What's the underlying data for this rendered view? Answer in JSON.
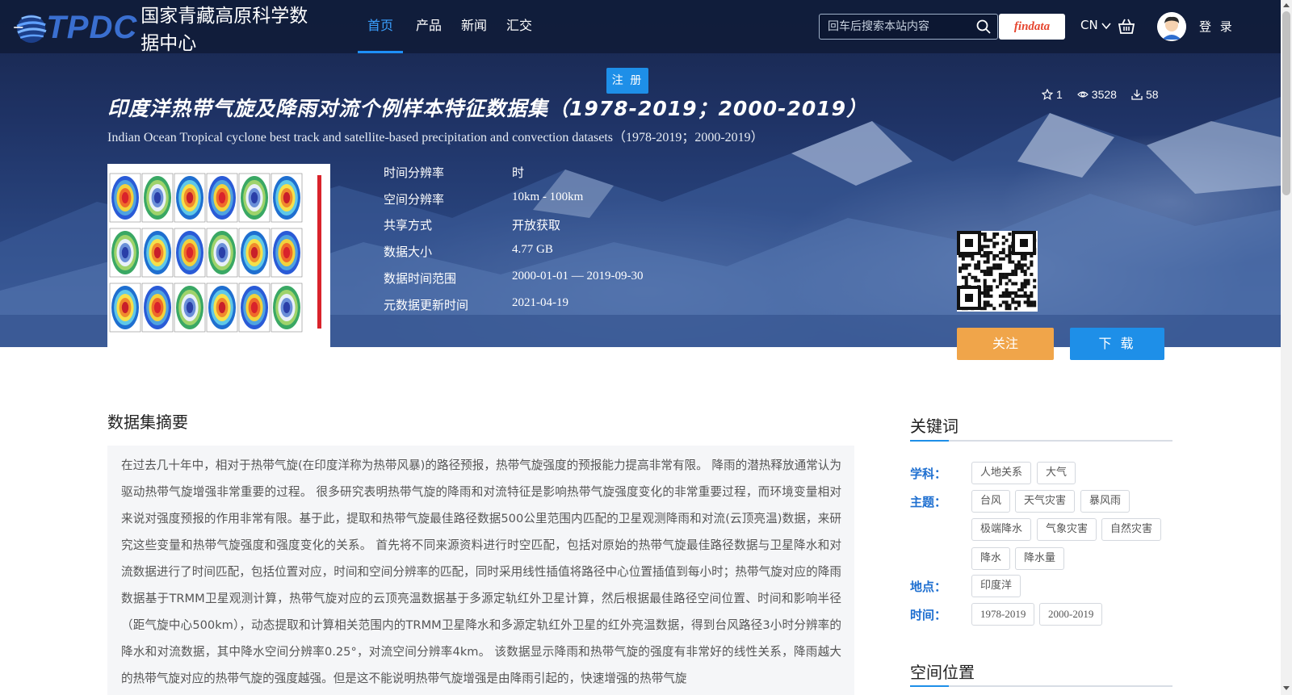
{
  "nav": {
    "logo_latin": "TPDC",
    "logo_cn": "国家青藏高原科学数据中心",
    "items": [
      {
        "label": "首页",
        "active": true
      },
      {
        "label": "产品"
      },
      {
        "label": "新闻"
      },
      {
        "label": "汇交"
      }
    ],
    "search_placeholder": "回车后搜索本站内容",
    "findata_label": "findata",
    "lang": "CN",
    "login": "登 录"
  },
  "register_label": "注 册",
  "dataset": {
    "title_cn": "印度洋热带气旋及降雨对流个例样本特征数据集（1978-2019；2000-2019）",
    "title_en": "Indian Ocean Tropical cyclone best track and satellite-based precipitation and convection datasets（1978-2019；2000-2019）",
    "stats": {
      "favorites": "1",
      "views": "3528",
      "downloads": "58"
    },
    "meta": [
      {
        "label": "时间分辨率",
        "value": "时"
      },
      {
        "label": "空间分辨率",
        "value": "10km - 100km"
      },
      {
        "label": "共享方式",
        "value": "开放获取"
      },
      {
        "label": "数据大小",
        "value": "4.77 GB"
      },
      {
        "label": "数据时间范围",
        "value": "2000-01-01 — 2019-09-30"
      },
      {
        "label": "元数据更新时间",
        "value": "2021-04-19"
      }
    ],
    "follow_label": "关注",
    "download_label": "下 载"
  },
  "abstract": {
    "heading": "数据集摘要",
    "text": "在过去几十年中，相对于热带气旋(在印度洋称为热带风暴)的路径预报，热带气旋强度的预报能力提高非常有限。 降雨的潜热释放通常认为驱动热带气旋增强非常重要的过程。 很多研究表明热带气旋的降雨和对流特征是影响热带气旋强度变化的非常重要过程，而环境变量相对来说对强度预报的作用非常有限。基于此，提取和热带气旋最佳路径数据500公里范围内匹配的卫星观测降雨和对流(云顶亮温)数据，来研究这些变量和热带气旋强度和强度变化的关系。 首先将不同来源资料进行时空匹配，包括对原始的热带气旋最佳路径数据与卫星降水和对流数据进行了时间匹配，包括位置对应，时间和空间分辨率的匹配，同时采用线性插值将路径中心位置插值到每小时；热带气旋对应的降雨数据基于TRMM卫星观测计算，热带气旋对应的云顶亮温数据基于多源定轨红外卫星计算，然后根据最佳路径空间位置、时间和影响半径（距气旋中心500km），动态提取和计算相关范围内的TRMM卫星降水和多源定轨红外卫星的红外亮温数据，得到台风路径3小时分辨率的降水和对流数据，其中降水空间分辨率0.25°，对流空间分辨率4km。 该数据显示降雨和热带气旋的强度有非常好的线性关系，降雨越大的热带气旋对应的热带气旋的强度越强。但是这不能说明热带气旋增强是由降雨引起的，快速增强的热带气旋"
  },
  "keywords": {
    "heading": "关键词",
    "groups": [
      {
        "label": "学科：",
        "tags": [
          "人地关系",
          "大气"
        ]
      },
      {
        "label": "主题：",
        "tags": [
          "台风",
          "天气灾害",
          "暴风雨",
          "极端降水",
          "气象灾害",
          "自然灾害",
          "降水",
          "降水量"
        ]
      },
      {
        "label": "地点：",
        "tags": [
          "印度洋"
        ]
      },
      {
        "label": "时间：",
        "tags": [
          "1978-2019",
          "2000-2019"
        ]
      }
    ]
  },
  "spatial": {
    "heading": "空间位置"
  },
  "colors": {
    "accent": "#1e8fe8",
    "follow": "#f0a54a",
    "nav_bg": "#101c3a",
    "label_blue": "#1e6fd0"
  }
}
